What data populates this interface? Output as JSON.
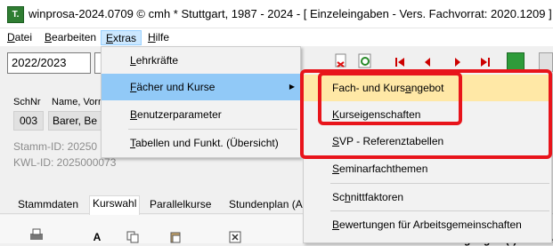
{
  "window": {
    "app_icon_text": "T.",
    "title": "winprosa-2024.0709 © cmh * Stuttgart, 1987 - 2024 - [ Einzeleingaben - Vers. Fachvorrat: 2020.1209 ]"
  },
  "menubar": {
    "datei": "atei",
    "datei_u": "D",
    "bearbeiten": "earbeiten",
    "bearbeiten_u": "B",
    "extras": "xtras",
    "extras_u": "E",
    "hilfe": "ilfe",
    "hilfe_u": "H"
  },
  "toolbar": {
    "year": "2022/2023"
  },
  "form": {
    "schnr_label": "SchNr",
    "name_label": "Name, Vorn",
    "schnr_value": "003",
    "name_value": "Barer, Be",
    "stamm_id": "Stamm-ID: 20250",
    "kwl_id": "KWL-ID:   2025000073"
  },
  "tabs": [
    "Stammdaten",
    "Kurswahl",
    "Parallelkurse",
    "Stundenplan (A"
  ],
  "bottom": {
    "right_text": "Standardbelegungen (*) für: be"
  },
  "extras_menu": {
    "items": [
      {
        "pre": "",
        "u": "L",
        "post": "ehrkräfte"
      },
      {
        "pre": "",
        "u": "F",
        "post": "ächer und Kurse"
      },
      {
        "pre": "",
        "u": "B",
        "post": "enutzerparameter"
      },
      {
        "pre": "",
        "u": "T",
        "post": "abellen und Funkt. (Übersicht)"
      }
    ],
    "submenu_arrow": "▶"
  },
  "sub_menu": {
    "items": [
      {
        "pre": "Fach- und Kurs",
        "u": "a",
        "post": "ngebot"
      },
      {
        "pre": "",
        "u": "K",
        "post": "urseigenschaften"
      },
      {
        "pre": "",
        "u": "S",
        "post": "VP - Referenztabellen"
      },
      {
        "pre": "",
        "u": "S",
        "post": "eminarfachthemen"
      },
      {
        "pre": "Sc",
        "u": "h",
        "post": "nittfaktoren"
      },
      {
        "pre": "",
        "u": "B",
        "post": "ewertungen für Arbeitsgemeinschaften"
      }
    ]
  },
  "colors": {
    "highlight_red": "#e8141b",
    "menu_hover_blue": "#91c9f7",
    "submenu_hover": "#ffe8a6"
  }
}
